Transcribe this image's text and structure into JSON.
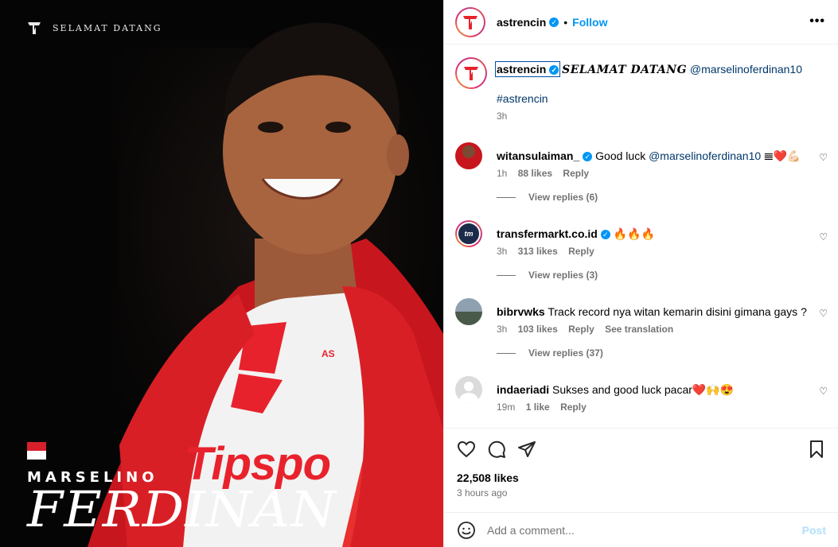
{
  "post_image": {
    "brand_text": "SELAMAT DATANG",
    "first_name": "MARSELINO",
    "last_name": "FERDINAN",
    "jersey_text": "Tipspo",
    "jersey_badge": "AS"
  },
  "header": {
    "username": "astrencin",
    "follow_label": "Follow",
    "dot": "•",
    "more": "•••"
  },
  "caption": {
    "username": "astrencin",
    "script_text": "SELAMAT DATANG",
    "mention": "@marselinoferdinan10",
    "hashtag": "#astrencin",
    "time": "3h"
  },
  "comments": [
    {
      "username": "witansulaiman_",
      "verified": true,
      "text": "Good luck",
      "mention": "@marselinoferdinan10",
      "emoji": "𝍣❤️💪🏻",
      "time": "1h",
      "likes": "88 likes",
      "reply": "Reply",
      "view_replies": "View replies (6)"
    },
    {
      "username": "transfermarkt.co.id",
      "verified": true,
      "text": "🔥🔥🔥",
      "time": "3h",
      "likes": "313 likes",
      "reply": "Reply",
      "view_replies": "View replies (3)"
    },
    {
      "username": "bibrvwks",
      "verified": false,
      "text": "Track record nya witan kemarin disini gimana gays ?",
      "time": "3h",
      "likes": "103 likes",
      "reply": "Reply",
      "see_translation": "See translation",
      "view_replies": "View replies (37)"
    },
    {
      "username": "indaeriadi",
      "verified": false,
      "text": "Sukses and good luck pacar❤️🙌😍",
      "time": "19m",
      "likes": "1 like",
      "reply": "Reply"
    }
  ],
  "actions": {
    "likes": "22,508 likes",
    "time_ago": "3 hours ago"
  },
  "add_comment": {
    "placeholder": "Add a comment...",
    "post_label": "Post"
  },
  "colors": {
    "link": "#00376b",
    "follow": "#0095f6",
    "muted": "#737373",
    "brand_red": "#e8222c"
  }
}
